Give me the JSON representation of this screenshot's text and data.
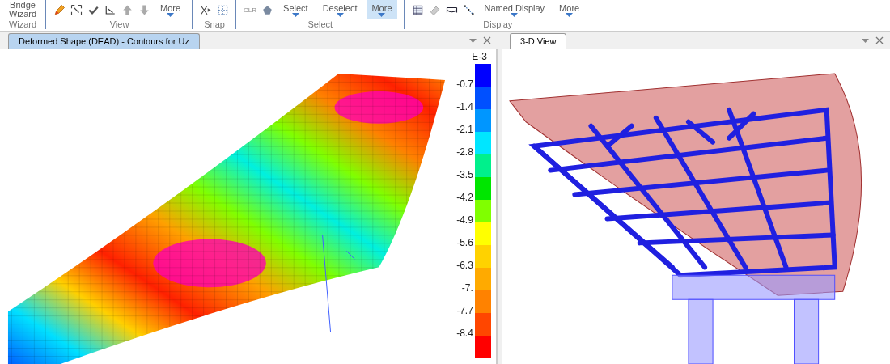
{
  "ribbon": {
    "groups": [
      {
        "label": "Wizard",
        "items": [
          {
            "kind": "text",
            "label": "Bridge Wizard"
          }
        ]
      },
      {
        "label": "View",
        "items": [
          {
            "kind": "icon"
          },
          {
            "kind": "icon"
          },
          {
            "kind": "icon"
          },
          {
            "kind": "icon"
          },
          {
            "kind": "icon"
          },
          {
            "kind": "icon"
          },
          {
            "kind": "menu",
            "label": "More",
            "selected": false
          }
        ]
      },
      {
        "label": "Snap",
        "items": [
          {
            "kind": "icon"
          },
          {
            "kind": "icon"
          }
        ]
      },
      {
        "label": "Select",
        "items": [
          {
            "kind": "clr",
            "label": "CLR"
          },
          {
            "kind": "icon"
          },
          {
            "kind": "menu",
            "label": "Select",
            "selected": false
          },
          {
            "kind": "menu",
            "label": "Deselect",
            "selected": false
          },
          {
            "kind": "menu",
            "label": "More",
            "selected": true
          }
        ]
      },
      {
        "label": "Display",
        "items": [
          {
            "kind": "icon"
          },
          {
            "kind": "icon"
          },
          {
            "kind": "icon"
          },
          {
            "kind": "icon"
          },
          {
            "kind": "menu",
            "label": "Named Display",
            "selected": false
          },
          {
            "kind": "menu",
            "label": "More",
            "selected": false
          }
        ]
      }
    ]
  },
  "panels": [
    {
      "tab": "Deformed Shape (DEAD) - Contours for Uz",
      "kind": "contour",
      "legend": {
        "title": "E-3",
        "items": [
          {
            "color": "#0000ff",
            "label": "-0.7"
          },
          {
            "color": "#0050ff",
            "label": "-1.4"
          },
          {
            "color": "#0096ff",
            "label": "-2.1"
          },
          {
            "color": "#00e6ff",
            "label": "-2.8"
          },
          {
            "color": "#00f08c",
            "label": "-3.5"
          },
          {
            "color": "#00e600",
            "label": "-4.2"
          },
          {
            "color": "#80ff00",
            "label": "-4.9"
          },
          {
            "color": "#ffff00",
            "label": "-5.6"
          },
          {
            "color": "#ffd200",
            "label": "-6.3"
          },
          {
            "color": "#ffaa00",
            "label": "-7."
          },
          {
            "color": "#ff8200",
            "label": "-7.7"
          },
          {
            "color": "#ff4600",
            "label": "-8.4"
          },
          {
            "color": "#ff0000"
          }
        ]
      }
    },
    {
      "tab": "3-D View",
      "kind": "model3d"
    }
  ]
}
